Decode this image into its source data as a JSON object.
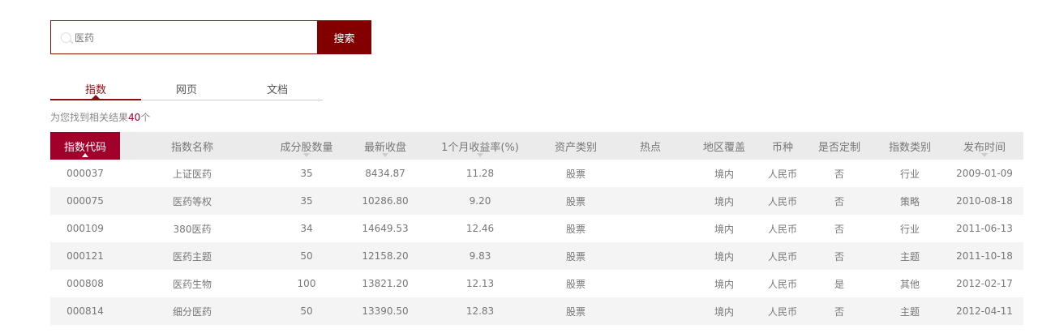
{
  "search": {
    "value": "医药",
    "button": "搜索"
  },
  "tabs": [
    "指数",
    "网页",
    "文档"
  ],
  "result": {
    "prefix": "为您找到相关结果",
    "count": "40",
    "suffix": "个"
  },
  "table": {
    "headers": [
      "指数代码",
      "指数名称",
      "成分股数量",
      "最新收盘",
      "1个月收益率(%)",
      "资产类别",
      "热点",
      "地区覆盖",
      "币种",
      "是否定制",
      "指数类别",
      "发布时间"
    ],
    "rows": [
      [
        "000037",
        "上证医药",
        "35",
        "8434.87",
        "11.28",
        "股票",
        "",
        "境内",
        "人民币",
        "否",
        "行业",
        "2009-01-09"
      ],
      [
        "000075",
        "医药等权",
        "35",
        "10286.80",
        "9.20",
        "股票",
        "",
        "境内",
        "人民币",
        "否",
        "策略",
        "2010-08-18"
      ],
      [
        "000109",
        "380医药",
        "34",
        "14649.53",
        "12.46",
        "股票",
        "",
        "境内",
        "人民币",
        "否",
        "行业",
        "2011-06-13"
      ],
      [
        "000121",
        "医药主题",
        "50",
        "12158.20",
        "9.83",
        "股票",
        "",
        "境内",
        "人民币",
        "否",
        "主题",
        "2011-10-18"
      ],
      [
        "000808",
        "医药生物",
        "100",
        "13821.20",
        "12.13",
        "股票",
        "",
        "境内",
        "人民币",
        "是",
        "其他",
        "2012-02-17"
      ],
      [
        "000814",
        "细分医药",
        "50",
        "13390.50",
        "12.83",
        "股票",
        "",
        "境内",
        "人民币",
        "否",
        "主题",
        "2012-04-11"
      ]
    ]
  },
  "colors": {
    "accent": "#a0002a",
    "search_button": "#820000"
  }
}
